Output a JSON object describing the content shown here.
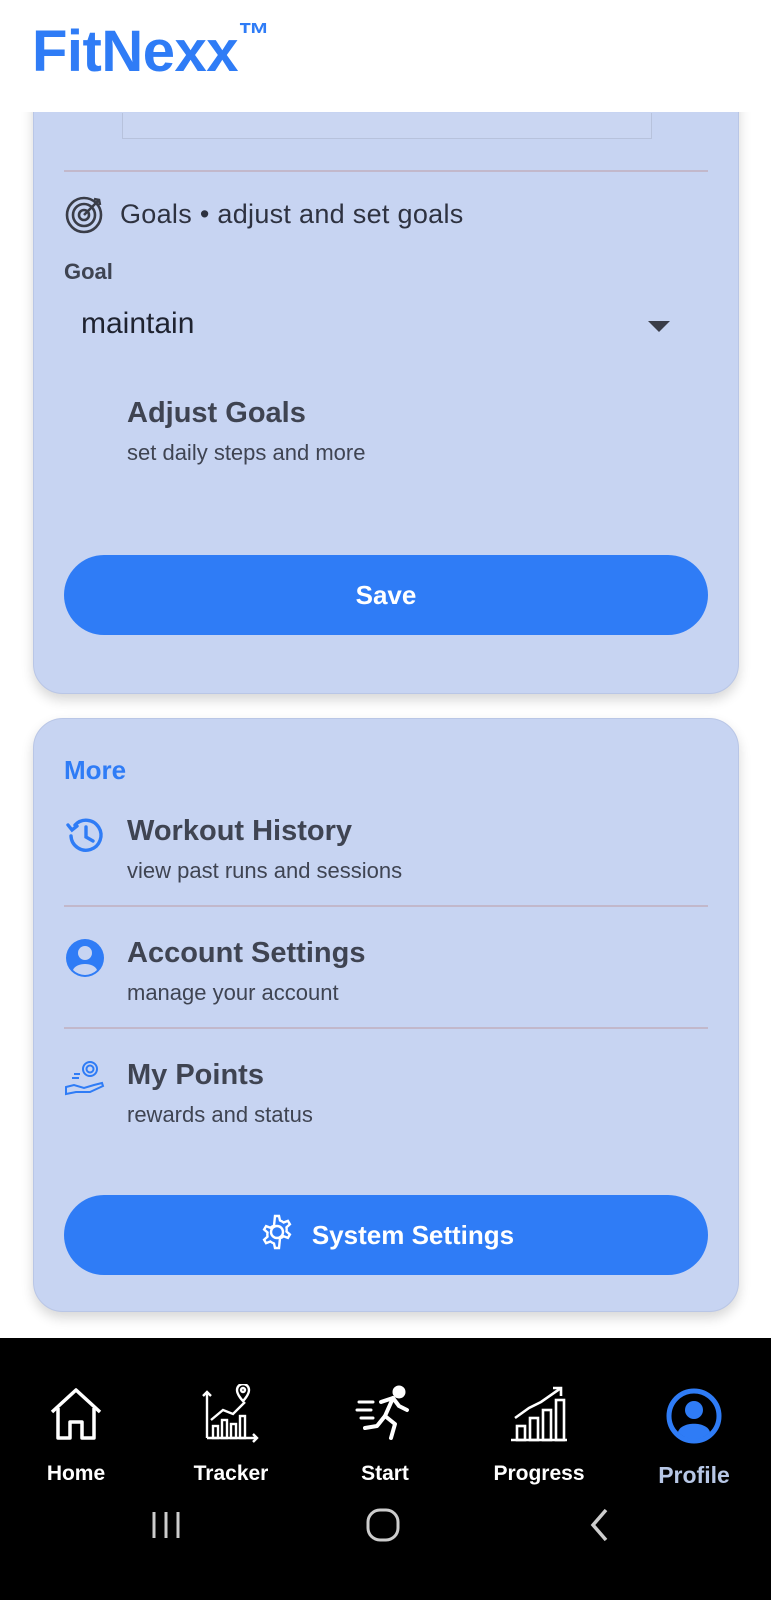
{
  "app": {
    "title": "FitNexx",
    "trademark": "™"
  },
  "goals_section": {
    "heading": "Goals • adjust and set goals",
    "field_label": "Goal",
    "goal_value": "maintain",
    "adjust_title": "Adjust Goals",
    "adjust_subtitle": "set daily steps and more",
    "save_label": "Save"
  },
  "more_section": {
    "label": "More",
    "items": [
      {
        "title": "Workout History",
        "subtitle": "view past runs and sessions",
        "icon": "history-icon"
      },
      {
        "title": "Account Settings",
        "subtitle": "manage your account",
        "icon": "account-circle-icon"
      },
      {
        "title": "My Points",
        "subtitle": "rewards and status",
        "icon": "points-hand-icon"
      }
    ],
    "system_settings_label": "System Settings"
  },
  "bottom_nav": {
    "items": [
      {
        "label": "Home",
        "icon": "home-icon"
      },
      {
        "label": "Tracker",
        "icon": "tracker-icon"
      },
      {
        "label": "Start",
        "icon": "runner-icon"
      },
      {
        "label": "Progress",
        "icon": "progress-chart-icon"
      },
      {
        "label": "Profile",
        "icon": "profile-icon",
        "active": true
      }
    ]
  },
  "colors": {
    "accent": "#2f7cf6",
    "card": "#c7d4f2",
    "nav_bg": "#000000",
    "active_label": "#b7c7e6"
  }
}
